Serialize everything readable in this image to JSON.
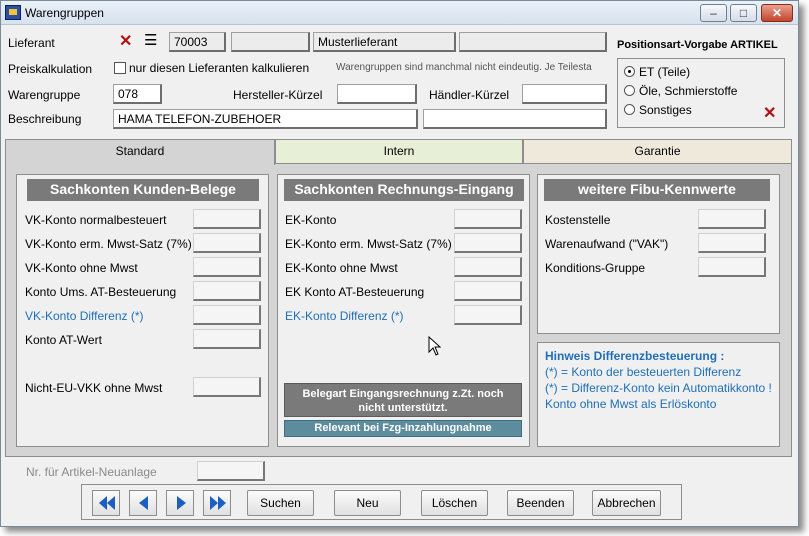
{
  "window": {
    "title": "Warengruppen",
    "minimize": "–",
    "maximize": "□",
    "close": "✕"
  },
  "header": {
    "lieferant_label": "Lieferant",
    "lieferant_nr": "70003",
    "lieferant_name": "Musterlieferant",
    "preiskalk_label": "Preiskalkulation",
    "preiskalk_checkbox": "nur diesen Lieferanten kalkulieren",
    "preiskalk_note": "Warengruppen sind manchmal nicht eindeutig. Je Teilesta",
    "warengruppe_label": "Warengruppe",
    "warengruppe_value": "078",
    "hersteller_label": "Hersteller-Kürzel",
    "haendler_label": "Händler-Kürzel",
    "beschreibung_label": "Beschreibung",
    "beschreibung_value": "HAMA TELEFON-ZUBEHOER"
  },
  "positionsart": {
    "title": "Positionsart-Vorgabe ARTIKEL",
    "options": [
      "ET (Teile)",
      "Öle, Schmierstoffe",
      "Sonstiges"
    ],
    "selected": "ET (Teile)"
  },
  "tabs": [
    "Standard",
    "Intern",
    "Garantie"
  ],
  "active_tab": "Standard",
  "kunden": {
    "title": "Sachkonten Kunden-Belege",
    "rows": [
      "VK-Konto normalbesteuert",
      "VK-Konto erm. Mwst-Satz (7%)",
      "VK-Konto ohne Mwst",
      "Konto Ums. AT-Besteuerung",
      "VK-Konto Differenz (*)",
      "Konto AT-Wert",
      "Nicht-EU-VKK ohne Mwst"
    ]
  },
  "rechnung": {
    "title": "Sachkonten Rechnungs-Eingang",
    "rows": [
      "EK-Konto",
      "EK-Konto erm. Mwst-Satz (7%)",
      "EK-Konto ohne Mwst",
      "EK Konto AT-Besteuerung",
      "EK-Konto Differenz (*)"
    ],
    "note_line1": "Belegart Eingangsrechnung z.Zt. noch",
    "note_line2": "nicht unterstützt.",
    "fzg_button": "Relevant bei Fzg-Inzahlungnahme"
  },
  "fibu": {
    "title": "weitere Fibu-Kennwerte",
    "rows": [
      "Kostenstelle",
      "Warenaufwand (\"VAK\")",
      "Konditions-Gruppe"
    ]
  },
  "hinweis": {
    "title": "Hinweis Differenzbesteuerung :",
    "lines": [
      "(*) = Konto der besteuerten Differenz",
      "(*) = Differenz-Konto kein Automatikkonto !",
      "Konto ohne Mwst als Erlöskonto"
    ]
  },
  "artikel_neuanlage_label": "Nr. für Artikel-Neuanlage",
  "nav": {
    "suchen": "Suchen",
    "neu": "Neu",
    "loeschen": "Löschen",
    "beenden": "Beenden",
    "abbrechen": "Abbrechen"
  },
  "colors": {
    "accent_blue": "#1f6fb8",
    "group_header": "#7a7a7a",
    "arrow_blue": "#1d5fc0"
  }
}
